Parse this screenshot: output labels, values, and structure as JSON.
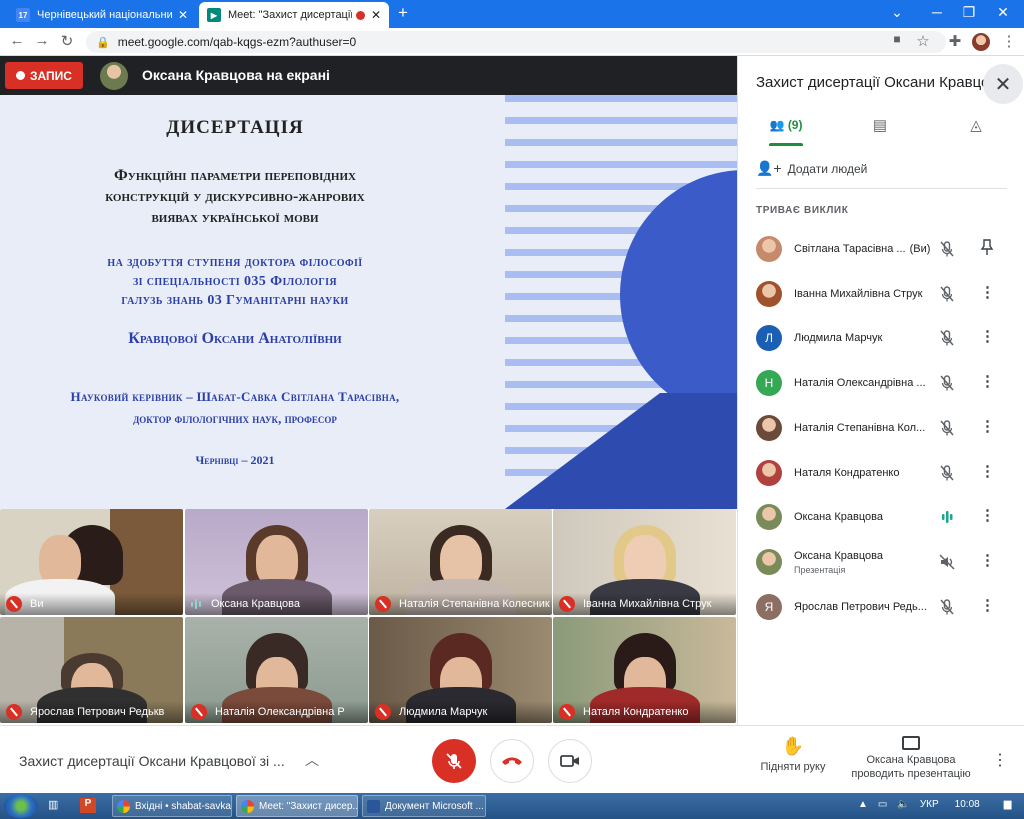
{
  "browser": {
    "tabs": [
      {
        "title": "Чернівецький національний ун",
        "favicon": "calendar-icon"
      },
      {
        "title": "Meet: \"Захист дисертації Ок",
        "favicon": "meet-icon",
        "recording": true
      }
    ],
    "url": "meet.google.com/qab-kqgs-ezm?authuser=0"
  },
  "meet_header": {
    "record_label": "ЗАПИС",
    "presenter_label": "Оксана Кравцова на екрані"
  },
  "slide": {
    "title": "ДИСЕРТАЦІЯ",
    "subtitle_lines": [
      "Функційні параметри переповідних",
      "конструкцій у дискурсивно-жанрових",
      "виявах української мови"
    ],
    "degree_lines": [
      "на здобуття ступеня доктора філософії",
      "зі спеціальності 035 Філологія",
      "галузь знань 03 Гуманітарні науки"
    ],
    "author": "Кравцової Оксани Анатоліївни",
    "supervisor_line1": "Науковий керівник – Шабат-Савка Світлана Тарасівна,",
    "supervisor_line2": "доктор філологічних наук, професор",
    "city_year": "Чернівці – 2021"
  },
  "tiles": [
    {
      "name": "Ви",
      "muted": true
    },
    {
      "name": "Оксана Кравцова",
      "muted": false
    },
    {
      "name": "Наталія Степанівна Колесник",
      "muted": true
    },
    {
      "name": "Іванна Михайлівна Струк",
      "muted": true
    },
    {
      "name": "Ярослав Петрович Редькв",
      "muted": true
    },
    {
      "name": "Наталія Олександрівна Р",
      "muted": true
    },
    {
      "name": "Людмила Марчук",
      "muted": true
    },
    {
      "name": "Наталя Кондратенко",
      "muted": true
    }
  ],
  "bottom_bar": {
    "meeting_name": "Захист дисертації Оксани Кравцової зі ...",
    "raise_hand_label": "Підняти руку",
    "presenting_line1": "Оксана Кравцова",
    "presenting_line2": "проводить презентацію"
  },
  "panel": {
    "title": "Захист дисертації Оксани Кравцової",
    "people_count": "(9)",
    "add_people": "Додати людей",
    "in_call_label": "ТРИВАЄ ВИКЛИК",
    "people": [
      {
        "name": "Світлана Тарасівна ...",
        "you": "(Ви)",
        "avatar_letter": "",
        "avatar_color": "#c58a6b",
        "status": "muted",
        "action": "pin"
      },
      {
        "name": "Іванна Михайлівна Струк",
        "avatar_letter": "",
        "avatar_color": "#a0522d",
        "status": "muted",
        "action": "menu"
      },
      {
        "name": "Людмила Марчук",
        "avatar_letter": "Л",
        "avatar_color": "#1a5fb4",
        "status": "muted",
        "action": "menu"
      },
      {
        "name": "Наталія Олександрівна ...",
        "avatar_letter": "Н",
        "avatar_color": "#34a853",
        "status": "muted",
        "action": "menu"
      },
      {
        "name": "Наталія Степанівна Кол...",
        "avatar_letter": "",
        "avatar_color": "#6b4a3a",
        "status": "muted",
        "action": "menu"
      },
      {
        "name": "Наталя Кондратенко",
        "avatar_letter": "",
        "avatar_color": "#b0413e",
        "status": "muted",
        "action": "menu"
      },
      {
        "name": "Оксана Кравцова",
        "avatar_letter": "",
        "avatar_color": "#7a8b5a",
        "status": "speaking",
        "action": "menu"
      },
      {
        "name": "Оксана Кравцова",
        "subtitle": "Презентація",
        "avatar_letter": "",
        "avatar_color": "#7a8b5a",
        "status": "sound-off",
        "action": "menu"
      },
      {
        "name": "Ярослав Петрович Редь...",
        "avatar_letter": "Я",
        "avatar_color": "#8d6e63",
        "status": "muted",
        "action": "menu"
      }
    ]
  },
  "taskbar": {
    "items": [
      "Вхідні • shabat-savka...",
      "Meet: \"Захист дисер...",
      "Документ Microsoft ..."
    ],
    "language": "УКР",
    "time": "10:08"
  }
}
